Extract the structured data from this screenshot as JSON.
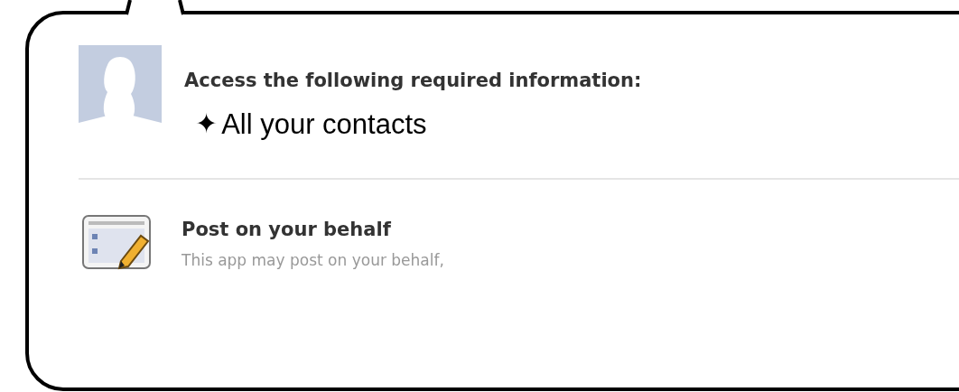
{
  "header": {
    "title": "Access the following required information:"
  },
  "required": [
    {
      "bullet": "✦",
      "label": "All your contacts"
    }
  ],
  "permissions": [
    {
      "kind": "publish",
      "title": "Post on your behalf",
      "description": "This app may post on your behalf,"
    }
  ]
}
